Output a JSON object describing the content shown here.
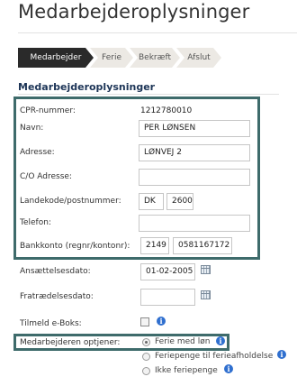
{
  "page": {
    "title": "Medarbejderoplysninger"
  },
  "wizard": {
    "steps": [
      {
        "label": "Medarbejder",
        "active": true
      },
      {
        "label": "Ferie",
        "active": false
      },
      {
        "label": "Bekræft",
        "active": false
      },
      {
        "label": "Afslut",
        "active": false
      }
    ]
  },
  "section": {
    "heading": "Medarbejderoplysninger"
  },
  "form": {
    "cpr": {
      "label": "CPR-nummer:",
      "value": "1212780010"
    },
    "name": {
      "label": "Navn:",
      "value": "PER LØNSEN"
    },
    "address": {
      "label": "Adresse:",
      "value": "LØNVEJ 2"
    },
    "co_address": {
      "label": "C/O Adresse:",
      "value": ""
    },
    "postal": {
      "label": "Landekode/postnummer:",
      "country": "DK",
      "zip": "2600"
    },
    "phone": {
      "label": "Telefon:",
      "value": ""
    },
    "bank": {
      "label": "Bankkonto (regnr/kontonr):",
      "reg": "2149",
      "account": "0581167172"
    },
    "employment_date": {
      "label": "Ansættelsesdato:",
      "value": "01-02-2005"
    },
    "resignation_date": {
      "label": "Fratrædelsesdato:",
      "value": ""
    },
    "eboks": {
      "label": "Tilmeld e-Boks:",
      "checked": false
    },
    "vacation": {
      "label": "Medarbejderen optjener:",
      "options": [
        {
          "label": "Ferie med løn",
          "selected": true
        },
        {
          "label": "Feriepenge til ferieafholdelse",
          "selected": false
        },
        {
          "label": "Ikke feriepenge",
          "selected": false
        }
      ]
    }
  },
  "icons": {
    "calendar": "calendar-icon",
    "info": "info-icon"
  },
  "colors": {
    "highlight_border": "#3e6b6b",
    "active_step": "#2a2a2a",
    "heading": "#1d3557",
    "info": "#2f6fcf"
  }
}
